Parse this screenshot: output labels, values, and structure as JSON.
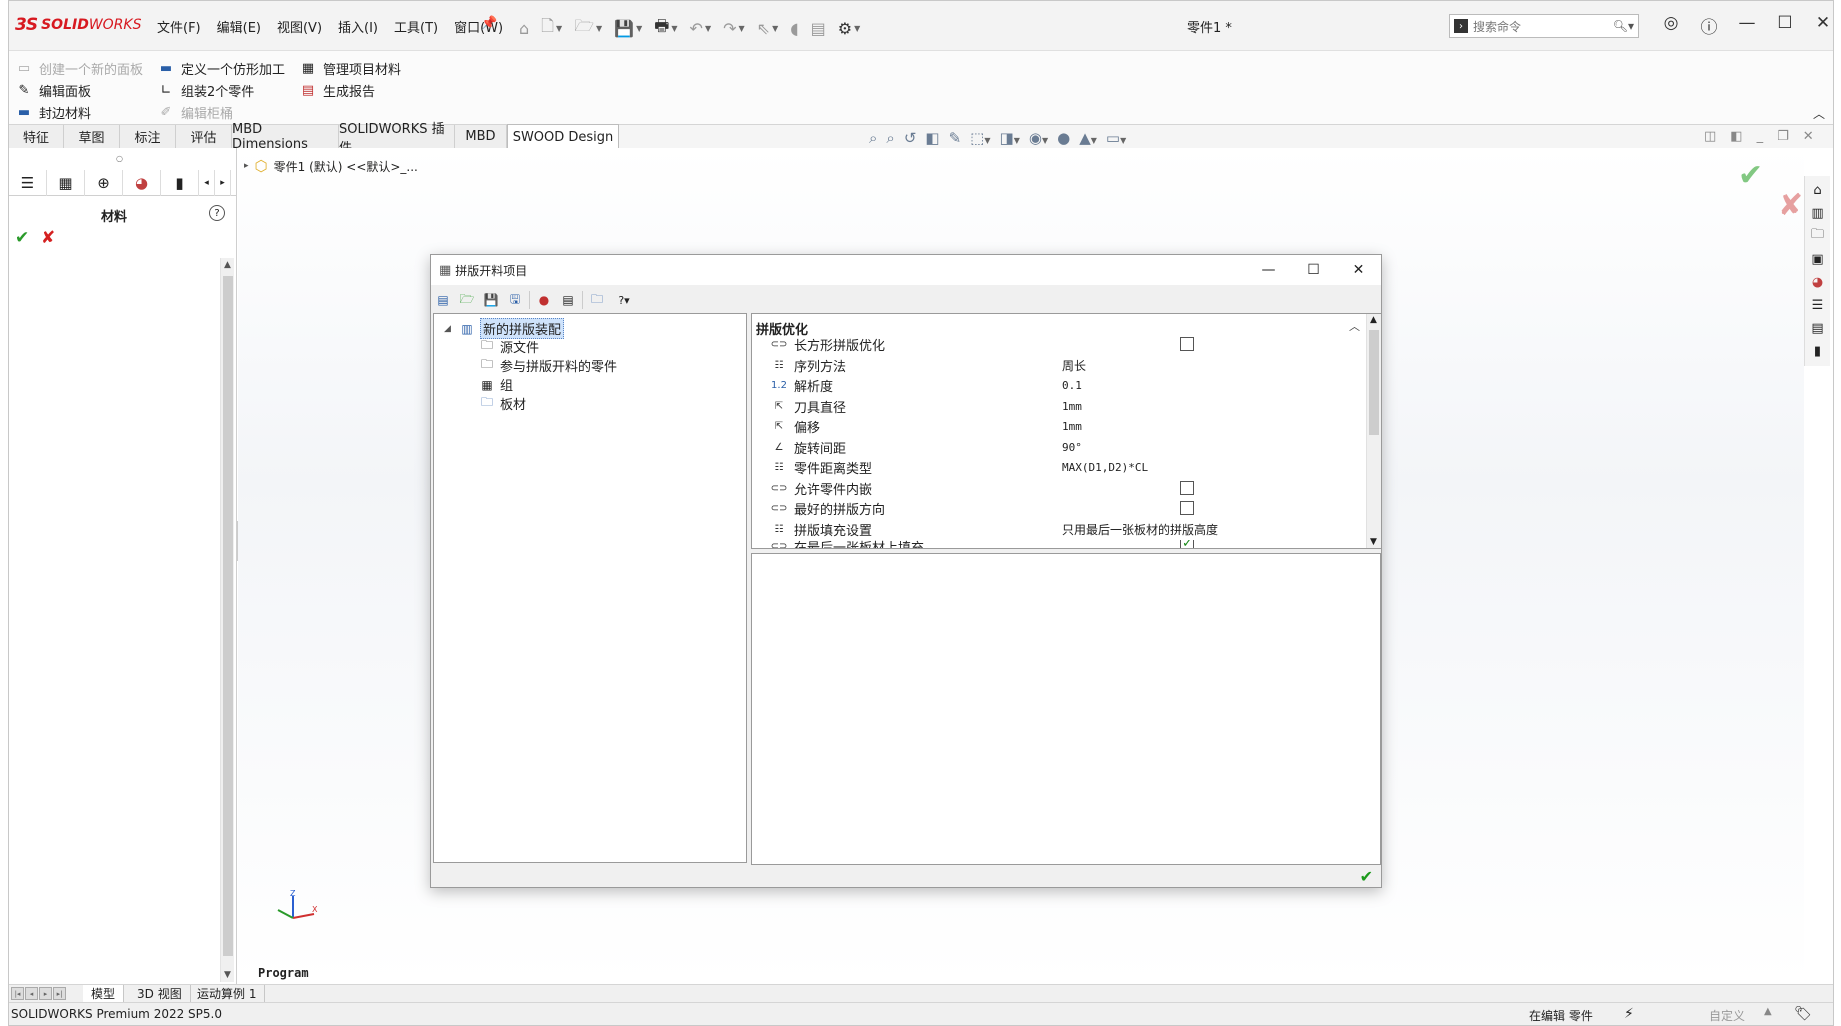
{
  "app": {
    "logo_ds": "3S",
    "logo_solid": "SOLID",
    "logo_works": "WORKS",
    "menus": [
      "文件(F)",
      "编辑(E)",
      "视图(V)",
      "插入(I)",
      "工具(T)",
      "窗口(W)"
    ],
    "doc_title": "零件1 *",
    "search_placeholder": "搜索命令"
  },
  "command_manager": {
    "create_panel": "创建一个新的面板",
    "define_profile": "定义一个仿形加工",
    "manage_materials": "管理项目材料",
    "edit_panel": "编辑面板",
    "assemble_parts": "组装2个零件",
    "generate_report": "生成报告",
    "edge_material": "封边材料",
    "edit_cabinet": "编辑柜桶"
  },
  "tabs": [
    "特征",
    "草图",
    "标注",
    "评估",
    "MBD Dimensions",
    "SOLIDWORKS 插件",
    "MBD",
    "SWOOD Design"
  ],
  "left_panel": {
    "title": "材料",
    "help": "?"
  },
  "tree_root": "零件1 (默认) <<默认>_...",
  "viewport_label": "Program",
  "dialog": {
    "title": "拼版开料项目",
    "help_button": "?",
    "tree": [
      {
        "label": "新的拼版装配",
        "selected": true
      },
      {
        "label": "源文件"
      },
      {
        "label": "参与拼版开料的零件"
      },
      {
        "label": "组"
      },
      {
        "label": "板材"
      }
    ],
    "group_header": "拼版优化",
    "properties": [
      {
        "name": "长方形拼版优化",
        "value": "",
        "checkbox": false
      },
      {
        "name": "序列方法",
        "value": "周长"
      },
      {
        "name": "解析度",
        "value": "0.1"
      },
      {
        "name": "刀具直径",
        "value": "1mm"
      },
      {
        "name": "偏移",
        "value": "1mm"
      },
      {
        "name": "旋转间距",
        "value": "90°"
      },
      {
        "name": "零件距离类型",
        "value": "MAX(D1,D2)*CL"
      },
      {
        "name": "允许零件内嵌",
        "value": "",
        "checkbox": false
      },
      {
        "name": "最好的拼版方向",
        "value": "",
        "checkbox": false
      },
      {
        "name": "拼版填充设置",
        "value": "只用最后一张板材的拼版高度"
      },
      {
        "name": "在最后一张板材上填充",
        "value": "",
        "checkbox": true
      }
    ]
  },
  "bottom_tabs": [
    "模型",
    "3D 视图",
    "运动算例 1"
  ],
  "status": {
    "product": "SOLIDWORKS Premium 2022 SP5.0",
    "editing": "在编辑 零件",
    "custom": "自定义"
  },
  "colors": {
    "brand": "#d71920",
    "ok_green": "#2a9a2a",
    "cancel_red": "#d42020",
    "selection": "#cfe3fb"
  }
}
